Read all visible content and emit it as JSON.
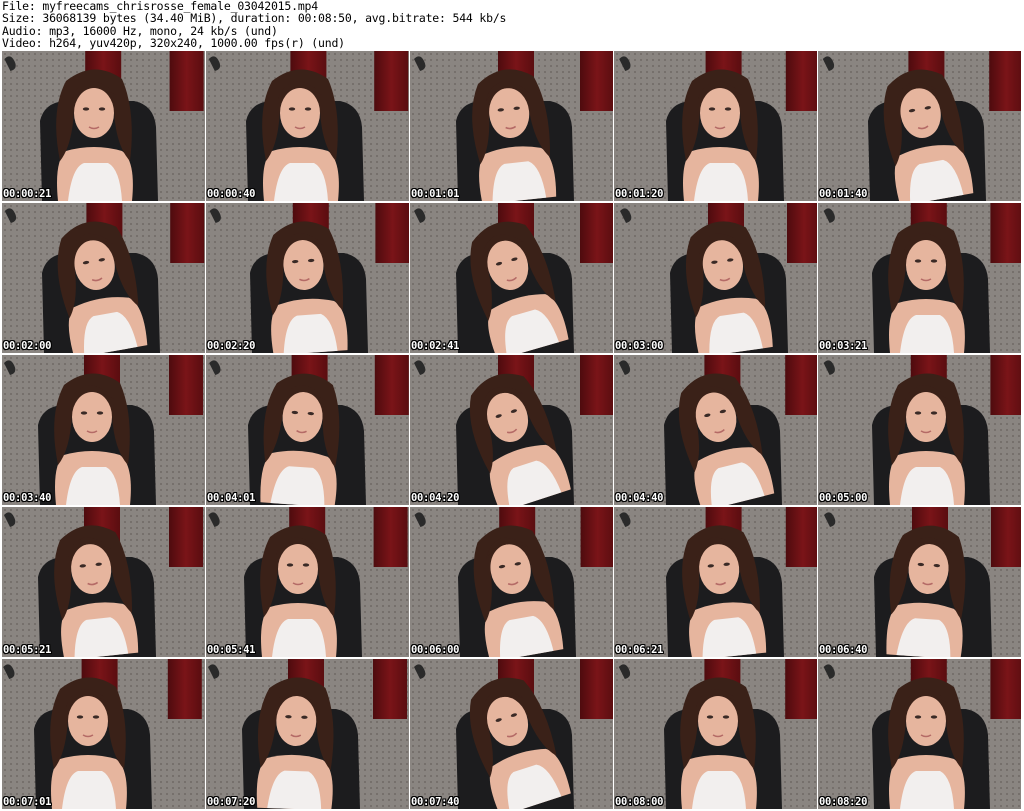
{
  "header": {
    "file_line": "File: myfreecams_chrisrosse_female_03042015.mp4",
    "size_line": "Size: 36068139 bytes (34.40 MiB), duration: 00:08:50, avg.bitrate: 544 kb/s",
    "audio_line": "Audio: mp3, 16000 Hz, mono, 24 kb/s (und)",
    "video_line": "Video: h264, yuv420p, 320x240, 1000.00 fps(r) (und)"
  },
  "colors": {
    "wall": "#8a8581",
    "curtain": "#7a1418",
    "chair": "#1c1c1e",
    "hair": "#3a2118",
    "skin": "#e6b59e",
    "shirt": "#f2efee"
  },
  "frames": [
    {
      "time": "00:00:21",
      "icon": "video-frame-thumbnail"
    },
    {
      "time": "00:00:40",
      "icon": "video-frame-thumbnail"
    },
    {
      "time": "00:01:01",
      "icon": "video-frame-thumbnail"
    },
    {
      "time": "00:01:20",
      "icon": "video-frame-thumbnail"
    },
    {
      "time": "00:01:40",
      "icon": "video-frame-thumbnail"
    },
    {
      "time": "00:02:00",
      "icon": "video-frame-thumbnail"
    },
    {
      "time": "00:02:20",
      "icon": "video-frame-thumbnail"
    },
    {
      "time": "00:02:41",
      "icon": "video-frame-thumbnail"
    },
    {
      "time": "00:03:00",
      "icon": "video-frame-thumbnail"
    },
    {
      "time": "00:03:21",
      "icon": "video-frame-thumbnail"
    },
    {
      "time": "00:03:40",
      "icon": "video-frame-thumbnail"
    },
    {
      "time": "00:04:01",
      "icon": "video-frame-thumbnail"
    },
    {
      "time": "00:04:20",
      "icon": "video-frame-thumbnail"
    },
    {
      "time": "00:04:40",
      "icon": "video-frame-thumbnail"
    },
    {
      "time": "00:05:00",
      "icon": "video-frame-thumbnail"
    },
    {
      "time": "00:05:21",
      "icon": "video-frame-thumbnail"
    },
    {
      "time": "00:05:41",
      "icon": "video-frame-thumbnail"
    },
    {
      "time": "00:06:00",
      "icon": "video-frame-thumbnail"
    },
    {
      "time": "00:06:21",
      "icon": "video-frame-thumbnail"
    },
    {
      "time": "00:06:40",
      "icon": "video-frame-thumbnail"
    },
    {
      "time": "00:07:01",
      "icon": "video-frame-thumbnail"
    },
    {
      "time": "00:07:20",
      "icon": "video-frame-thumbnail"
    },
    {
      "time": "00:07:40",
      "icon": "video-frame-thumbnail"
    },
    {
      "time": "00:08:00",
      "icon": "video-frame-thumbnail"
    },
    {
      "time": "00:08:20",
      "icon": "video-frame-thumbnail"
    }
  ]
}
